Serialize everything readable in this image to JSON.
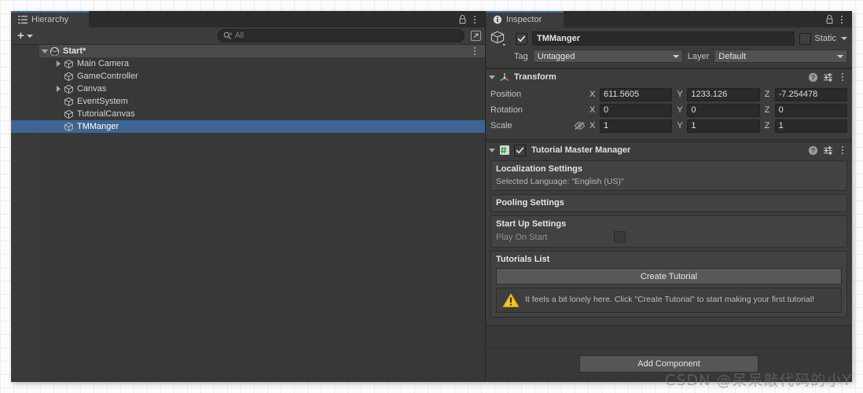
{
  "window": {
    "hierarchy_panel": {
      "tab_label": "Hierarchy",
      "tab_icon": "hierarchy-icon",
      "lock_icon": "lock-icon",
      "menu_icon": "kebab-menu-icon",
      "toolbar": {
        "add_label": "+",
        "add_icon": "plus-icon",
        "dropdown_icon": "chevron-down-icon",
        "search_icon": "search-icon",
        "search_value": "",
        "search_placeholder": "All",
        "expand_icon": "expand-window-icon"
      },
      "tree": [
        {
          "label": "Start*",
          "depth": 0,
          "icon": "unity-scene-icon",
          "twisty": "down",
          "selected": false,
          "scene": true
        },
        {
          "label": "Main Camera",
          "depth": 1,
          "icon": "gameobject-icon",
          "twisty": "right",
          "selected": false,
          "scene": false
        },
        {
          "label": "GameController",
          "depth": 1,
          "icon": "gameobject-icon",
          "twisty": "none",
          "selected": false,
          "scene": false
        },
        {
          "label": "Canvas",
          "depth": 1,
          "icon": "gameobject-icon",
          "twisty": "right",
          "selected": false,
          "scene": false
        },
        {
          "label": "EventSystem",
          "depth": 1,
          "icon": "gameobject-icon",
          "twisty": "none",
          "selected": false,
          "scene": false
        },
        {
          "label": "TutorialCanvas",
          "depth": 1,
          "icon": "gameobject-icon",
          "twisty": "none",
          "selected": false,
          "scene": false
        },
        {
          "label": "TMManger",
          "depth": 1,
          "icon": "gameobject-icon",
          "twisty": "none",
          "selected": true,
          "scene": false
        }
      ]
    },
    "inspector_panel": {
      "tab_label": "Inspector",
      "tab_icon": "info-icon",
      "lock_icon": "lock-icon",
      "menu_icon": "kebab-menu-icon",
      "game_object": {
        "prefab_icon": "gameobject-cube-icon",
        "enabled": true,
        "name": "TMManger",
        "static_label": "Static",
        "static_checked": false,
        "tag_label": "Tag",
        "tag_value": "Untagged",
        "layer_label": "Layer",
        "layer_value": "Default"
      },
      "transform": {
        "title": "Transform",
        "icon": "transform-gizmo-icon",
        "expanded": true,
        "help_icon": "help-icon",
        "preset_icon": "preset-icon",
        "menu_icon": "kebab-menu-icon",
        "rows": [
          {
            "label": "Position",
            "eye": false,
            "x": "611.5605",
            "y": "1233.126",
            "z": "-7.254478"
          },
          {
            "label": "Rotation",
            "eye": false,
            "x": "0",
            "y": "0",
            "z": "0"
          },
          {
            "label": "Scale",
            "eye": true,
            "eye_icon": "eye-off-icon",
            "x": "1",
            "y": "1",
            "z": "1"
          }
        ],
        "axis_labels": {
          "x": "X",
          "y": "Y",
          "z": "Z"
        }
      },
      "tutorial_master_manager": {
        "title": "Tutorial Master Manager",
        "script_icon": "csharp-script-icon",
        "enabled": true,
        "expanded": true,
        "help_icon": "help-icon",
        "preset_icon": "preset-icon",
        "menu_icon": "kebab-menu-icon",
        "localization": {
          "title": "Localization Settings",
          "selected_language_text": "Selected Language: \"English (US)\""
        },
        "pooling": {
          "title": "Pooling Settings"
        },
        "startup": {
          "title": "Start Up Settings",
          "play_on_start_label": "Play On Start",
          "play_on_start_checked": false
        },
        "tutorials_list": {
          "title": "Tutorials List",
          "create_button_label": "Create Tutorial",
          "warning_icon": "warning-triangle-icon",
          "warning_text": "It feels a bit lonely here. Click \"Create Tutorial\" to start making your first tutorial!"
        }
      },
      "add_component_label": "Add Component"
    }
  },
  "watermark": "CSDN @呆呆敲代码的小Y",
  "colors": {
    "window_bg": "#383838",
    "panel_bg": "#3c3c3c",
    "tabstrip_bg": "#2c2c2c",
    "selection_blue": "#3d6593",
    "active_tab_accent": "#3b6ea5",
    "field_bg": "#2a2a2a",
    "warning_yellow": "#f4c01e",
    "script_green": "#4caf50"
  }
}
